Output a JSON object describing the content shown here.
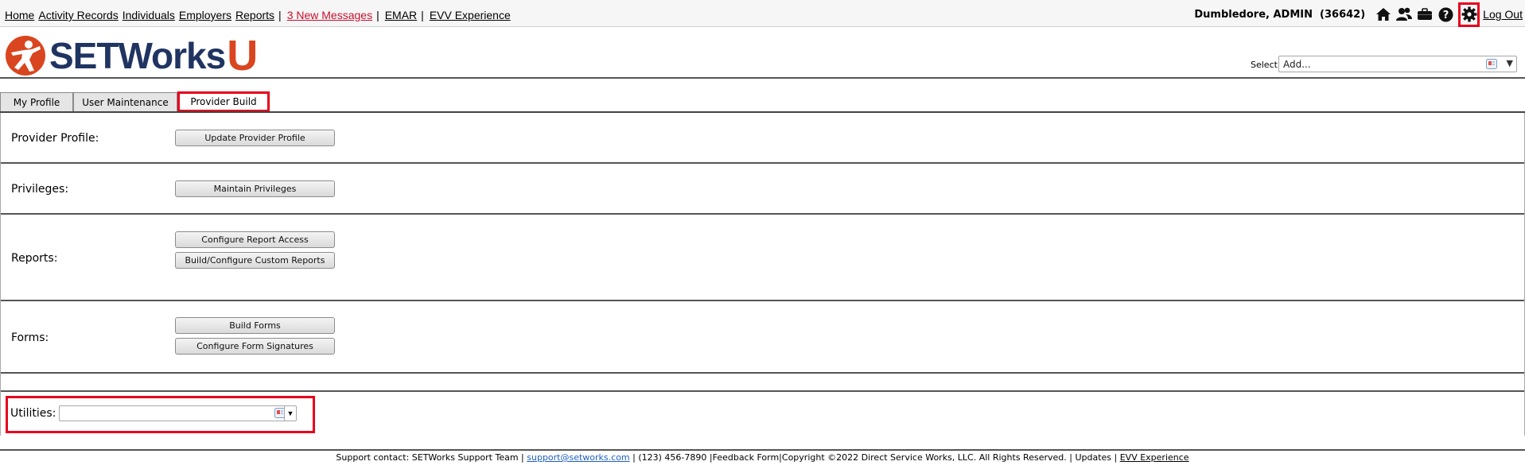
{
  "nav": {
    "home": "Home",
    "activity_records": "Activity Records",
    "individuals": "Individuals",
    "employers": "Employers",
    "reports": "Reports",
    "new_messages": "3 New Messages",
    "emar": "EMAR",
    "evv_experience": "EVV Experience",
    "separator": "|"
  },
  "user": {
    "name": "Dumbledore, ADMIN",
    "id": "(36642)",
    "logout": "Log Out"
  },
  "icons": [
    "home-icon",
    "people-icon",
    "briefcase-icon",
    "help-icon",
    "gear-icon"
  ],
  "brand": {
    "logo_text": "SETWorks",
    "logo_u": "U",
    "colors": {
      "navy": "#1f3461",
      "orange": "#d9451f",
      "red": "#c8102e",
      "highlight": "#e8001c"
    }
  },
  "select": {
    "label": "Select:",
    "value": "Add..."
  },
  "tabs": [
    {
      "label": "My Profile"
    },
    {
      "label": "User Maintenance"
    },
    {
      "label": "Provider Build"
    }
  ],
  "sections": {
    "provider_profile": {
      "label": "Provider Profile:",
      "buttons": [
        "Update Provider Profile"
      ]
    },
    "privileges": {
      "label": "Privileges:",
      "buttons": [
        "Maintain Privileges"
      ]
    },
    "reports": {
      "label": "Reports:",
      "buttons": [
        "Configure Report Access",
        "Build/Configure Custom Reports"
      ]
    },
    "forms": {
      "label": "Forms:",
      "buttons": [
        "Build Forms",
        "Configure Form Signatures"
      ]
    },
    "utilities": {
      "label": "Utilities:",
      "value": ""
    }
  },
  "footer": {
    "support_prefix": "Support contact: SETWorks Support Team |",
    "email": "support@setworks.com",
    "middle": "| (123) 456-7890 |Feedback Form|Copyright ©2022 Direct Service Works, LLC. All Rights Reserved.  |  Updates  |",
    "evv": "EVV Experience"
  }
}
